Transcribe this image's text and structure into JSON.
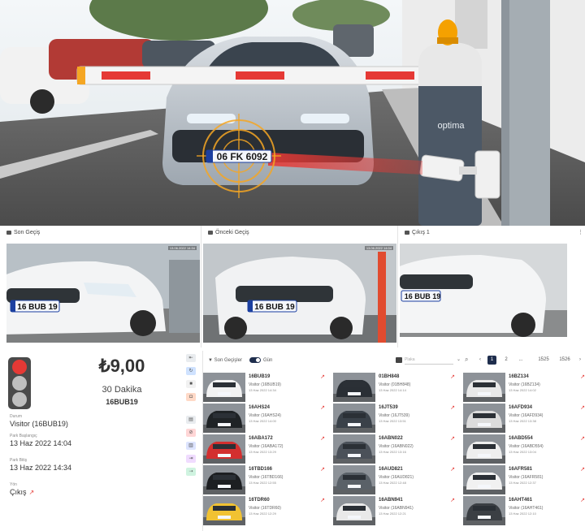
{
  "hero": {
    "plate": "06 FK 6092",
    "brand": "optima"
  },
  "cameras": [
    {
      "title": "Son Geçiş",
      "stamp": "13.06.2022 14:34",
      "plate": "16 BUB 19"
    },
    {
      "title": "Önceki Geçiş",
      "stamp": "13.06.2022 14:04",
      "plate": "16 BUB 19"
    },
    {
      "title": "Çıkış 1",
      "stamp": "",
      "plate": "16 BUB 19"
    }
  ],
  "info": {
    "price": "₺9,00",
    "duration": "30 Dakika",
    "plate": "16BUB19",
    "fields": [
      {
        "label": "Durum",
        "value": "Visitor (16BUB19)"
      },
      {
        "label": "Park Başlangıç",
        "value": "13 Haz 2022 14:04"
      },
      {
        "label": "Park Bitiş",
        "value": "13 Haz 2022 14:34"
      },
      {
        "label": "Yön",
        "value": "Çıkış"
      }
    ],
    "side_buttons": [
      {
        "icon": "back-icon",
        "glyph": "⇤",
        "color": "#e9ecef"
      },
      {
        "icon": "refresh-icon",
        "glyph": "↻",
        "color": "#cfe2ff"
      },
      {
        "icon": "lock-icon",
        "glyph": "■",
        "color": "#f1f1f1"
      },
      {
        "icon": "camera-icon",
        "glyph": "◘",
        "color": "#ffd9c7"
      },
      {
        "icon": "card-icon",
        "glyph": "▤",
        "color": "#e9ecef"
      },
      {
        "icon": "stop-icon",
        "glyph": "⊘",
        "color": "#ffd6d6"
      },
      {
        "icon": "print-icon",
        "glyph": "▥",
        "color": "#dde4ff"
      },
      {
        "icon": "gate-icon",
        "glyph": "⇥",
        "color": "#f0dcff"
      },
      {
        "icon": "open-icon",
        "glyph": "⇢",
        "color": "#cff3e0"
      }
    ]
  },
  "toolbar": {
    "title": "Son Geçişler",
    "date_label": "Gün",
    "filter_placeholder": "Plaka",
    "search_glyph": "⌕",
    "pages": [
      "‹",
      "1",
      "2",
      "...",
      "1525",
      "1526",
      "›"
    ],
    "active_page": "1"
  },
  "entries": [
    {
      "plate": "16BUB19",
      "who": "Visitor (16BUB19)",
      "when": "13 Haz 2022 14:34",
      "dir": "↗"
    },
    {
      "plate": "01BH848",
      "who": "Visitor (01BH848)",
      "when": "13 Haz 2022 14:14",
      "dir": "↗"
    },
    {
      "plate": "16BZ134",
      "who": "Visitor (16BZ134)",
      "when": "13 Haz 2022 14:02",
      "dir": "↗"
    },
    {
      "plate": "16AHS24",
      "who": "Visitor (16AHS24)",
      "when": "13 Haz 2022 14:00",
      "dir": "↗"
    },
    {
      "plate": "16JT539",
      "who": "Visitor (16JT539)",
      "when": "13 Haz 2022 13:51",
      "dir": "↗"
    },
    {
      "plate": "16AFD934",
      "who": "Visitor (16AFD934)",
      "when": "13 Haz 2022 13:38",
      "dir": "↗"
    },
    {
      "plate": "16ABA172",
      "who": "Visitor (16ABA172)",
      "when": "13 Haz 2022 13:29",
      "dir": "↗"
    },
    {
      "plate": "16ABN022",
      "who": "Visitor (16ABN022)",
      "when": "13 Haz 2022 13:16",
      "dir": "↗"
    },
    {
      "plate": "16ABD554",
      "who": "Visitor (16ABD554)",
      "when": "13 Haz 2022 13:04",
      "dir": "↗"
    },
    {
      "plate": "16TBD166",
      "who": "Visitor (16TBD166)",
      "when": "13 Haz 2022 12:55",
      "dir": "↗"
    },
    {
      "plate": "16AUD821",
      "who": "Visitor (16AUD821)",
      "when": "13 Haz 2022 12:48",
      "dir": "↗"
    },
    {
      "plate": "16AFR581",
      "who": "Visitor (16AFR581)",
      "when": "13 Haz 2022 12:37",
      "dir": "↗"
    },
    {
      "plate": "16TDR60",
      "who": "Visitor (16TDR60)",
      "when": "13 Haz 2022 12:29",
      "dir": "↗"
    },
    {
      "plate": "16ABN941",
      "who": "Visitor (16ABN941)",
      "when": "13 Haz 2022 12:21",
      "dir": "↗"
    },
    {
      "plate": "16AHT461",
      "who": "Visitor (16AHT461)",
      "when": "13 Haz 2022 12:10",
      "dir": "↗"
    }
  ],
  "colors": {
    "accent": "#1f2e4d",
    "red": "#e53935",
    "plate_bg": "#f5f7fb",
    "plate_blue": "#1b3fa0"
  }
}
